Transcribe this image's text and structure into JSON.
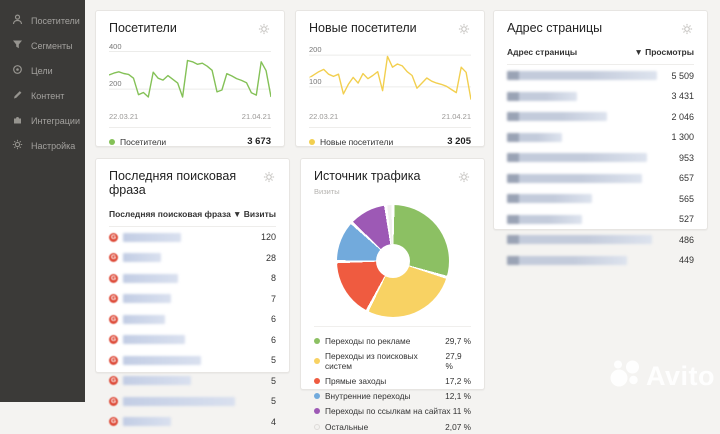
{
  "sidebar": {
    "items": [
      {
        "label": "Посетители",
        "icon": "person-icon"
      },
      {
        "label": "Сегменты",
        "icon": "funnel-icon"
      },
      {
        "label": "Цели",
        "icon": "target-icon"
      },
      {
        "label": "Контент",
        "icon": "pencil-icon"
      },
      {
        "label": "Интеграции",
        "icon": "puzzle-icon"
      },
      {
        "label": "Настройка",
        "icon": "gear-icon"
      }
    ]
  },
  "cards": {
    "visitors": {
      "title": "Посетители",
      "date_from": "22.03.21",
      "date_to": "21.04.21",
      "legend_label": "Посетители",
      "total": "3 673",
      "color": "#84c157"
    },
    "new_visitors": {
      "title": "Новые посетители",
      "date_from": "22.03.21",
      "date_to": "21.04.21",
      "legend_label": "Новые посетители",
      "total": "3 205",
      "color": "#f2cf4f"
    },
    "page_address": {
      "title": "Адрес страницы",
      "col1": "Адрес страницы",
      "col2": "▼ Просмотры",
      "rows": [
        {
          "views": "5 509",
          "bar": 150
        },
        {
          "views": "3 431",
          "bar": 70
        },
        {
          "views": "2 046",
          "bar": 100
        },
        {
          "views": "1 300",
          "bar": 55
        },
        {
          "views": "953",
          "bar": 140
        },
        {
          "views": "657",
          "bar": 135
        },
        {
          "views": "565",
          "bar": 85
        },
        {
          "views": "527",
          "bar": 75
        },
        {
          "views": "486",
          "bar": 145
        },
        {
          "views": "449",
          "bar": 120
        }
      ]
    },
    "search_phrase": {
      "title": "Последняя поисковая фраза",
      "col1": "Последняя поисковая фраза",
      "col2": "▼ Визиты",
      "row_icon": "G",
      "rows": [
        {
          "visits": "120",
          "bar": 58
        },
        {
          "visits": "28",
          "bar": 38
        },
        {
          "visits": "8",
          "bar": 55
        },
        {
          "visits": "7",
          "bar": 48
        },
        {
          "visits": "6",
          "bar": 42
        },
        {
          "visits": "6",
          "bar": 62
        },
        {
          "visits": "5",
          "bar": 78
        },
        {
          "visits": "5",
          "bar": 68
        },
        {
          "visits": "5",
          "bar": 112
        },
        {
          "visits": "4",
          "bar": 48
        }
      ]
    },
    "traffic_source": {
      "title": "Источник трафика",
      "subtitle": "Визиты"
    }
  },
  "watermark": {
    "text": "Avito"
  },
  "chart_data": [
    {
      "type": "line",
      "target": "chart-visitors",
      "title": "Посетители",
      "x_range": [
        "22.03.21",
        "21.04.21"
      ],
      "ylim": [
        110,
        440
      ],
      "gridlines": [
        200,
        400
      ],
      "series": [
        {
          "name": "Посетители",
          "color": "#84c157",
          "values": [
            275,
            285,
            292,
            283,
            278,
            258,
            170,
            182,
            158,
            290,
            258,
            248,
            272,
            252,
            232,
            158,
            352,
            345,
            332,
            338,
            322,
            300,
            185,
            195,
            282,
            270,
            256,
            246,
            234,
            180,
            168,
            345,
            298,
            158
          ]
        }
      ],
      "total": 3673
    },
    {
      "type": "line",
      "target": "chart-new-visitors",
      "title": "Новые посетители",
      "x_range": [
        "22.03.21",
        "21.04.21"
      ],
      "ylim": [
        40,
        235
      ],
      "gridlines": [
        100,
        200
      ],
      "series": [
        {
          "name": "Новые посетители",
          "color": "#f2cf4f",
          "values": [
            128,
            138,
            148,
            155,
            140,
            133,
            140,
            78,
            108,
            130,
            112,
            142,
            126,
            136,
            148,
            88,
            196,
            162,
            172,
            166,
            148,
            136,
            96,
            112,
            128,
            118,
            112,
            108,
            102,
            92,
            82,
            162,
            146,
            60
          ]
        }
      ],
      "total": 3205
    },
    {
      "type": "pie",
      "target": "traffic-pie",
      "title": "Источник трафика",
      "unit": "Визиты",
      "slices": [
        {
          "label": "Переходы по рекламе",
          "value": 29.7,
          "display": "29,7 %",
          "color": "#8cc063"
        },
        {
          "label": "Переходы из поисковых систем",
          "value": 27.9,
          "display": "27,9 %",
          "color": "#f8d263"
        },
        {
          "label": "Прямые заходы",
          "value": 17.2,
          "display": "17,2 %",
          "color": "#ef5b40"
        },
        {
          "label": "Внутренние переходы",
          "value": 12.1,
          "display": "12,1 %",
          "color": "#72aadc"
        },
        {
          "label": "Переходы по ссылкам на сайтах",
          "value": 11,
          "display": "11 %",
          "color": "#9d59b5"
        },
        {
          "label": "Остальные",
          "value": 2.07,
          "display": "2,07 %",
          "color": "#f1f0ee",
          "outline": true
        }
      ]
    }
  ]
}
